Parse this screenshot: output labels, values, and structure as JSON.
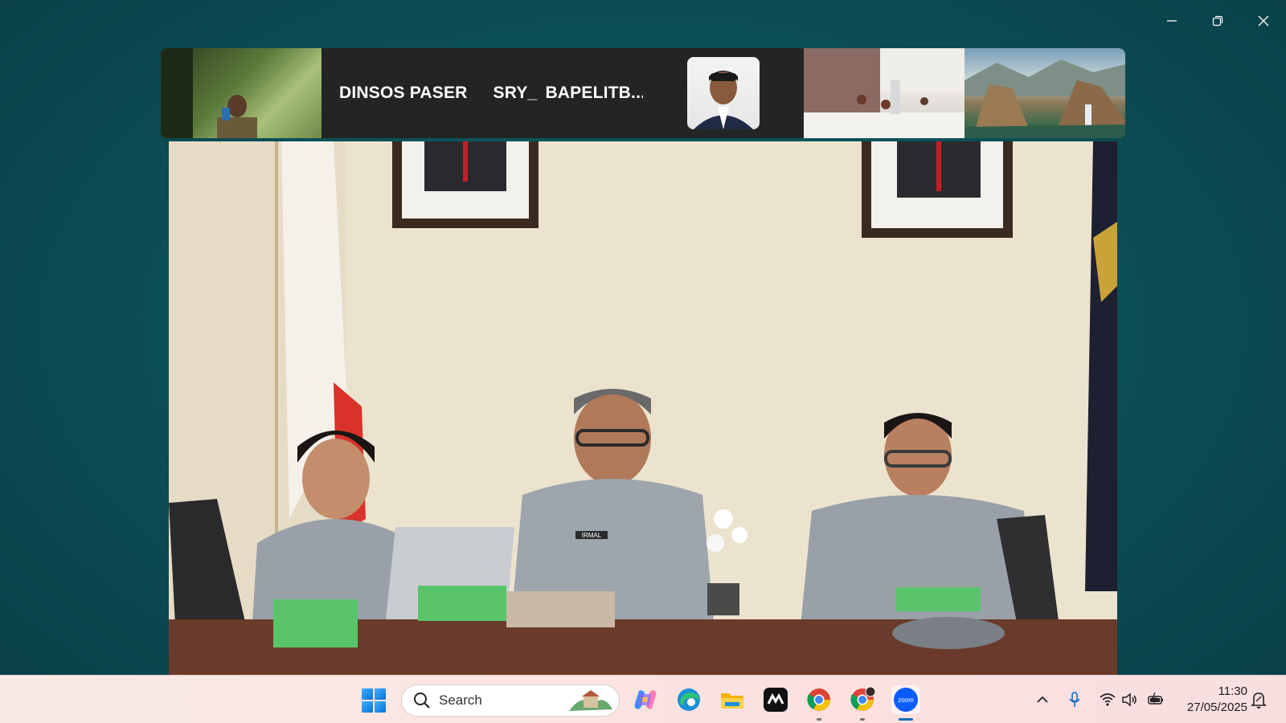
{
  "window": {
    "controls": [
      "minimize-icon",
      "restore-icon",
      "close-icon"
    ]
  },
  "gallery": {
    "tiles": [
      {
        "type": "video"
      },
      {
        "type": "names",
        "names": [
          "DINSOS PASER",
          "SRY_",
          "BAPELITB..."
        ]
      },
      {
        "type": "avatar"
      },
      {
        "type": "video"
      },
      {
        "type": "video"
      }
    ]
  },
  "main_video": {
    "name_tag": "IRMAL"
  },
  "taskbar": {
    "search_placeholder": "Search",
    "apps": [
      "windows-start-icon",
      "copilot-icon",
      "edge-icon",
      "file-explorer-icon",
      "capcut-icon",
      "chrome-icon",
      "chrome-profile-icon",
      "zoom-icon"
    ],
    "zoom_label": "zoom",
    "tray_icons": [
      "chevron-up-icon",
      "microphone-icon",
      "wifi-icon",
      "volume-icon",
      "battery-icon"
    ],
    "time": "11:30",
    "date": "27/05/2025"
  },
  "colors": {
    "background": "#0c4f56",
    "taskbar": "#fbe6e2",
    "accent": "#0f6cbd",
    "zoom": "#0b5cff"
  }
}
